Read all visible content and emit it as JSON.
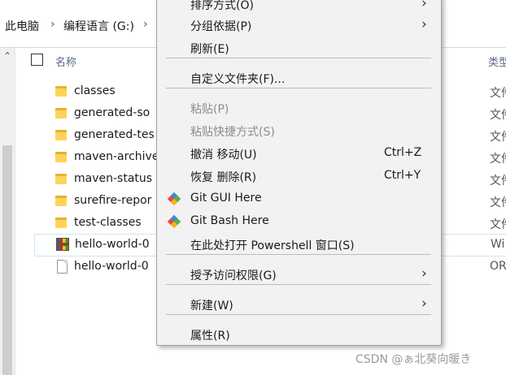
{
  "breadcrumb": {
    "items": [
      "此电脑",
      "编程语言 (G:)"
    ],
    "separator": "›"
  },
  "list": {
    "header_name": "名称",
    "header_type": "类型",
    "files": [
      {
        "name": "classes",
        "type": "文件",
        "icon": "folder"
      },
      {
        "name": "generated-so",
        "type": "文件",
        "icon": "folder"
      },
      {
        "name": "generated-tes",
        "type": "文件",
        "icon": "folder"
      },
      {
        "name": "maven-archive",
        "type": "文件",
        "icon": "folder"
      },
      {
        "name": "maven-status",
        "type": "文件",
        "icon": "folder"
      },
      {
        "name": "surefire-repor",
        "type": "文件",
        "icon": "folder"
      },
      {
        "name": "test-classes",
        "type": "文件",
        "icon": "folder"
      },
      {
        "name": "hello-world-0",
        "type": "Wi",
        "icon": "zip-archive",
        "selected": true
      },
      {
        "name": "hello-world-0",
        "type": "OR",
        "icon": "document"
      }
    ]
  },
  "menu": {
    "items": [
      {
        "label": "排序方式(O)",
        "arrow": "›"
      },
      {
        "label": "分组依据(P)",
        "arrow": "›"
      },
      {
        "label": "刷新(E)"
      },
      {
        "label": "自定义文件夹(F)..."
      },
      {
        "label": "粘贴(P)",
        "disabled": true
      },
      {
        "label": "粘贴快捷方式(S)",
        "disabled": true
      },
      {
        "label": "撤消 移动(U)",
        "shortcut": "Ctrl+Z"
      },
      {
        "label": "恢复 删除(R)",
        "shortcut": "Ctrl+Y"
      },
      {
        "label": "Git GUI Here",
        "icon": "git-icon"
      },
      {
        "label": "Git Bash Here",
        "icon": "git-icon"
      },
      {
        "label": "在此处打开 Powershell 窗口(S)"
      },
      {
        "label": "授予访问权限(G)",
        "arrow": "›"
      },
      {
        "label": "新建(W)",
        "arrow": "›"
      },
      {
        "label": "属性(R)"
      }
    ]
  },
  "watermark": "CSDN @ぁ北葵向暖き",
  "colors": {
    "menu_bg": "#f2f2f2",
    "disabled_text": "#8c8c8c",
    "folder": "#ffd35b",
    "selection_border": "#cce4f7"
  }
}
